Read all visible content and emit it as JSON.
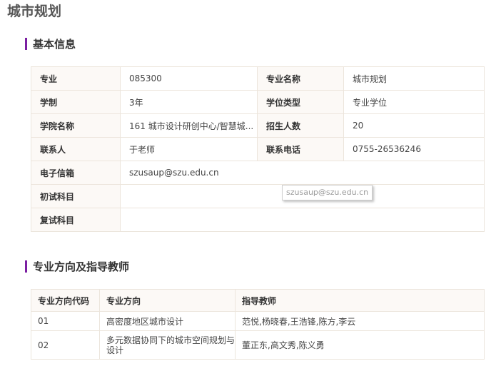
{
  "page": {
    "title": "城市规划"
  },
  "sections": {
    "basic_info": "基本信息",
    "directions": "专业方向及指导教师"
  },
  "info": {
    "major_label": "专业",
    "major_value": "085300",
    "major_name_label": "专业名称",
    "major_name_value": "城市规划",
    "system_label": "学制",
    "system_value": "3年",
    "degree_type_label": "学位类型",
    "degree_type_value": "专业学位",
    "college_label": "学院名称",
    "college_value": "161 城市设计研创中心/智慧城...",
    "enroll_label": "招生人数",
    "enroll_value": "20",
    "contact_label": "联系人",
    "contact_value": "于老师",
    "phone_label": "联系电话",
    "phone_value": "0755-26536246",
    "email_label": "电子信箱",
    "email_value": "szusaup@szu.edu.cn",
    "first_exam_label": "初试科目",
    "first_exam_value": "",
    "second_exam_label": "复试科目",
    "second_exam_value": ""
  },
  "tooltip": {
    "text": "szusaup@szu.edu.cn"
  },
  "directions": {
    "headers": [
      "专业方向代码",
      "专业方向",
      "指导教师"
    ],
    "rows": [
      {
        "code": "01",
        "name": "高密度地区城市设计",
        "teachers": "范悦,杨晓春,王浩锋,陈方,李云"
      },
      {
        "code": "02",
        "name": "多元数据协同下的城市空间规划与设计",
        "teachers": "董正东,高文秀,陈义勇"
      }
    ]
  },
  "colors": {
    "accent_bar": "#7b1fa2",
    "label_bg": "#fcf9f6",
    "border": "#ece5dc"
  }
}
